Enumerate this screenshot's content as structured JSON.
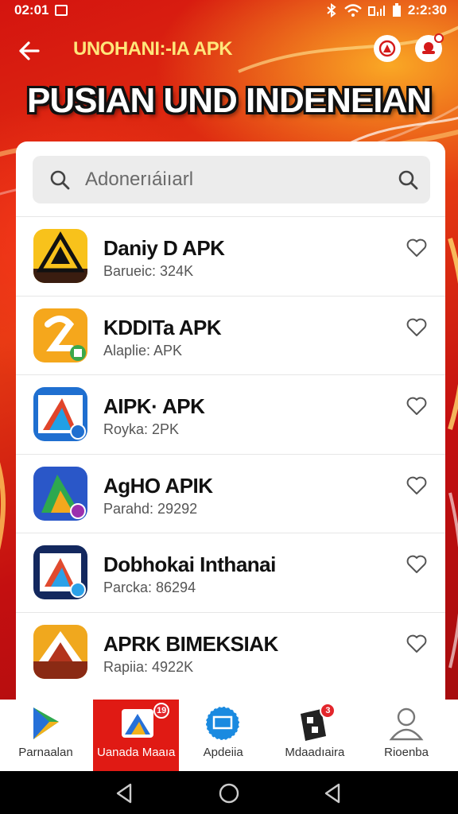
{
  "status_bar": {
    "time_left": "02:01",
    "time_right": "2:2:30"
  },
  "app_bar": {
    "title": "UNOHANI:-IA APK"
  },
  "headline": "PUSIAN UND INDENEIAN",
  "search": {
    "placeholder": "Adonerıáiıarl"
  },
  "apps": [
    {
      "name": "Daniy D APK",
      "meta": "Barueic: 324K",
      "icon": "warning-triangle-app-icon"
    },
    {
      "name": "KDDITa APK",
      "meta": "Alaplie: APK",
      "icon": "orange-z-app-icon"
    },
    {
      "name": "AIPK· APK",
      "meta": "Royka: 2PK",
      "icon": "blue-arrow-app-icon"
    },
    {
      "name": "AgHO APIK",
      "meta": "Parahd: 29292",
      "icon": "triangle-play-app-icon"
    },
    {
      "name": "Dobhokai Inthanai",
      "meta": "Parcka: 86294",
      "icon": "navy-book-app-icon"
    },
    {
      "name": "APRK BIMEKSIAK",
      "meta": "Rapiia: 4922K",
      "icon": "mountain-app-icon"
    }
  ],
  "bottom_nav": [
    {
      "label": "Parnaalan",
      "icon": "play-store-icon"
    },
    {
      "label": "Uanada Maaıa",
      "icon": "photo-app-icon",
      "badge": "19"
    },
    {
      "label": "Apdeiia",
      "icon": "monitor-badge-icon"
    },
    {
      "label": "Mdaadıaira",
      "icon": "game-card-icon",
      "badge": "3"
    },
    {
      "label": "Rioenba",
      "icon": "profile-icon"
    }
  ],
  "colors": {
    "brand_red": "#e01a14",
    "title_yellow": "#ffe67a"
  }
}
